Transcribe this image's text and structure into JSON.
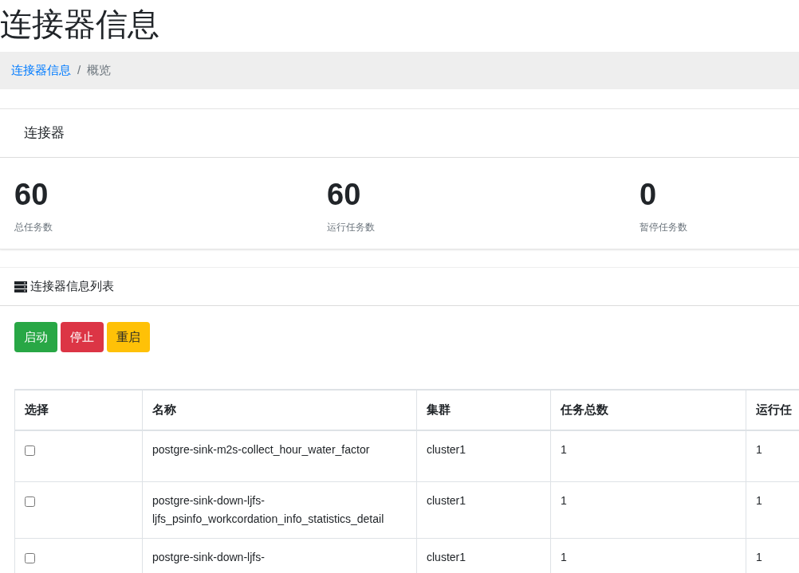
{
  "page_title": "连接器信息",
  "breadcrumb": [
    {
      "label": "连接器信息",
      "kind": "link"
    },
    {
      "label": "/",
      "kind": "separator"
    },
    {
      "label": "概览",
      "kind": "current"
    }
  ],
  "summary_card": {
    "title": "连接器",
    "stats": [
      {
        "value": "60",
        "label": "总任务数"
      },
      {
        "value": "60",
        "label": "运行任务数"
      },
      {
        "value": "0",
        "label": "暂停任务数"
      }
    ]
  },
  "list_card": {
    "title": "连接器信息列表",
    "buttons": [
      {
        "label": "启动",
        "kind": "success"
      },
      {
        "label": "停止",
        "kind": "danger"
      },
      {
        "label": "重启",
        "kind": "warning"
      }
    ],
    "table": {
      "select_header": "选择",
      "columns": [
        "名称",
        "集群",
        "任务总数",
        "运行任"
      ],
      "rows": [
        {
          "checked": false,
          "cells": [
            "postgre-sink-m2s-collect_hour_water_factor",
            "cluster1",
            "1",
            "1"
          ]
        },
        {
          "checked": false,
          "cells": [
            "postgre-sink-down-ljfs-ljfs_psinfo_workcordation_info_statistics_detail",
            "cluster1",
            "1",
            "1"
          ]
        },
        {
          "checked": false,
          "cells": [
            "postgre-sink-down-ljfs-",
            "cluster1",
            "1",
            "1"
          ]
        }
      ]
    }
  }
}
